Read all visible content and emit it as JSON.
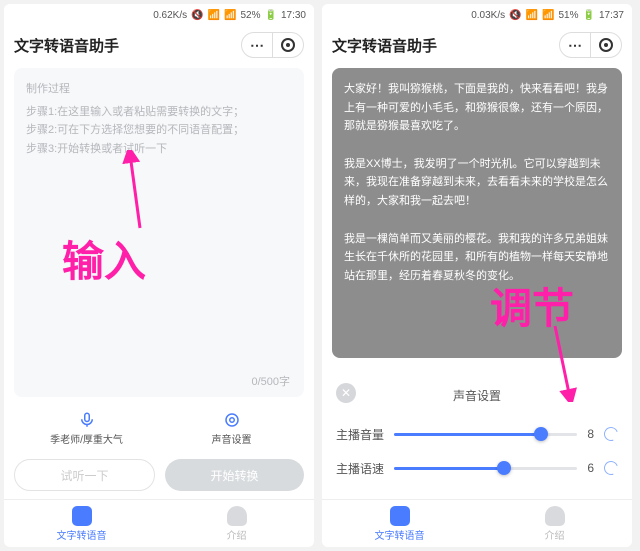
{
  "left": {
    "status": {
      "net": "0.62K/s",
      "battery": "52%",
      "time": "17:30"
    },
    "title": "文字转语音助手",
    "placeholder": {
      "heading": "制作过程",
      "step1": "步骤1:在这里输入或者粘贴需要转换的文字；",
      "step2": "步骤2:可在下方选择您想要的不同语音配置；",
      "step3": "步骤3:开始转换或者试听一下"
    },
    "count": "0/500字",
    "options": {
      "voice": "季老师/厚重大气",
      "setting": "声音设置"
    },
    "buttons": {
      "try": "试听一下",
      "start": "开始转换"
    },
    "nav": {
      "tts": "文字转语音",
      "about": "介绍"
    }
  },
  "right": {
    "status": {
      "net": "0.03K/s",
      "battery": "51%",
      "time": "17:37"
    },
    "title": "文字转语音助手",
    "content": {
      "p1": "大家好！我叫猕猴桃，下面是我的，快来看看吧！我身上有一种可爱的小毛毛，和猕猴很像，还有一个原因，那就是猕猴最喜欢吃了。",
      "p2": "我是XX博士，我发明了一个时光机。它可以穿越到未来，我现在准备穿越到未来，去看看未来的学校是怎么样的，大家和我一起去吧！",
      "p3": "我是一棵简单而又美丽的樱花。我和我的许多兄弟姐妹生长在千休所的花园里，和所有的植物一样每天安静地站在那里，经历着春夏秋冬的变化。"
    },
    "sheet": {
      "title": "声音设置",
      "volume_label": "主播音量",
      "volume_value": "8",
      "speed_label": "主播语速",
      "speed_value": "6"
    },
    "nav": {
      "tts": "文字转语音",
      "about": "介绍"
    }
  },
  "annotations": {
    "left": "输入",
    "right": "调节"
  },
  "slider_values": {
    "volume_pct": 80,
    "speed_pct": 60
  }
}
